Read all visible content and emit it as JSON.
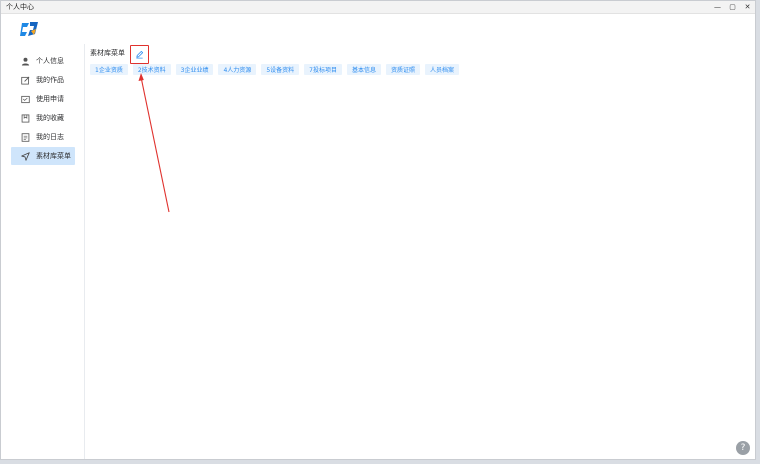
{
  "window": {
    "title": "个人中心",
    "controls": [
      "—",
      "▢",
      "✕"
    ]
  },
  "sidebar": {
    "items": [
      {
        "label": "个人信息",
        "icon": "user-icon"
      },
      {
        "label": "我的作品",
        "icon": "edit-icon"
      },
      {
        "label": "使用申请",
        "icon": "form-icon"
      },
      {
        "label": "我的收藏",
        "icon": "bookmark-icon"
      },
      {
        "label": "我的日志",
        "icon": "document-icon"
      },
      {
        "label": "素材库菜单",
        "icon": "send-icon",
        "active": true
      }
    ]
  },
  "main": {
    "section_title": "素材库菜单",
    "tags": [
      "1企业资质",
      "2技术资料",
      "3企业业绩",
      "4人力资源",
      "5设备资料",
      "7投标项目",
      "基本信息",
      "资质证照",
      "人员档案"
    ]
  },
  "help": "?",
  "colors": {
    "accent": "#2d8cf0",
    "highlight": "#e0322e",
    "active_bg": "#cfe5fb"
  }
}
